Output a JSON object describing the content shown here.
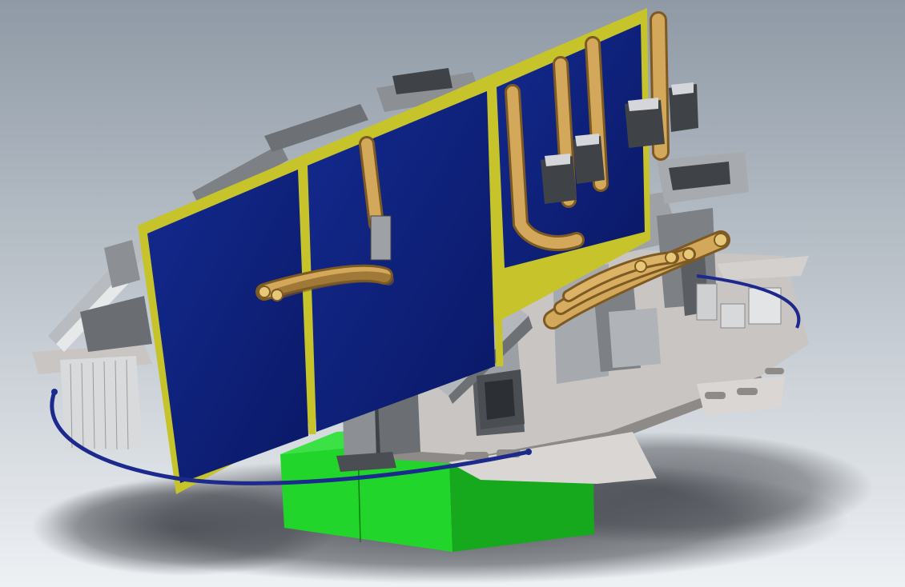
{
  "viewport": {
    "background_top": "#8f9aa6",
    "background_bottom": "#eef1f4",
    "shadow_color": "#3a3e44"
  },
  "model": {
    "panel_fill": "#0c1f78",
    "panel_frame": "#c6c42a",
    "base_green": "#21d52a",
    "base_green_dark": "#16a81d",
    "plate_gray": "#c9c5c3",
    "plate_edge": "#8e8a88",
    "hose_tan": "#c4984a",
    "hose_dark": "#7d5a23",
    "cable_blue": "#1b2a8c",
    "machine_gray": "#8c8f94",
    "machine_dark": "#3f4348",
    "machine_light": "#d4d6d9"
  }
}
